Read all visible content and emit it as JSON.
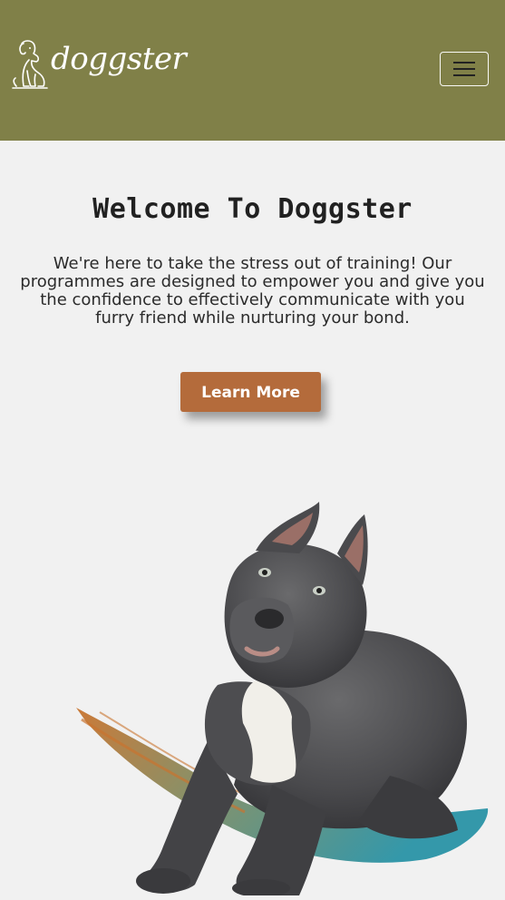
{
  "brand": {
    "name": "doggster",
    "logo_icon": "dog-outline-icon"
  },
  "nav": {
    "toggle_icon": "hamburger-menu-icon"
  },
  "hero": {
    "title": "Welcome To Doggster",
    "text": "We're here to take the stress out of training! Our programmes are designed to empower you and give you the confidence to effectively communicate with you furry friend while nurturing your bond.",
    "cta_label": "Learn More",
    "image_alt": "dog-photo"
  },
  "colors": {
    "navbar": "#808048",
    "background": "#f1f1f1",
    "cta": "#b46b3b",
    "brush_orange": "#c9742f",
    "brush_teal": "#2a93a6"
  }
}
